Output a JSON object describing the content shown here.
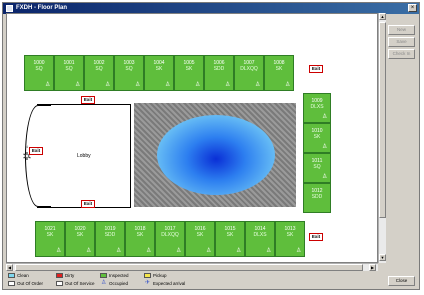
{
  "window": {
    "title": "FXDH - Floor Plan",
    "close_glyph": "×"
  },
  "exit_label": "Exit",
  "lobby_label": "Lobby",
  "compass_label": "N",
  "top_rooms": [
    {
      "number": "1000",
      "type": "SQ"
    },
    {
      "number": "1001",
      "type": "SQ"
    },
    {
      "number": "1002",
      "type": "SQ"
    },
    {
      "number": "1003",
      "type": "SQ"
    },
    {
      "number": "1004",
      "type": "SK"
    },
    {
      "number": "1005",
      "type": "SK"
    },
    {
      "number": "1006",
      "type": "SDD"
    },
    {
      "number": "1007",
      "type": "DLXQQ"
    },
    {
      "number": "1008",
      "type": "SK"
    }
  ],
  "right_rooms": [
    {
      "number": "1009",
      "type": "DLXS"
    },
    {
      "number": "1010",
      "type": "SK"
    },
    {
      "number": "1011",
      "type": "SQ"
    },
    {
      "number": "1012",
      "type": "SDD"
    }
  ],
  "bottom_rooms": [
    {
      "number": "1021",
      "type": "SK"
    },
    {
      "number": "1020",
      "type": "SK"
    },
    {
      "number": "1019",
      "type": "SDD"
    },
    {
      "number": "1018",
      "type": "SK"
    },
    {
      "number": "1017",
      "type": "DLXQQ"
    },
    {
      "number": "1016",
      "type": "SK"
    },
    {
      "number": "1015",
      "type": "SK"
    },
    {
      "number": "1014",
      "type": "DLXS"
    },
    {
      "number": "1013",
      "type": "SK"
    }
  ],
  "occupied_glyph": "♙",
  "side_buttons": {
    "new": "New",
    "save": "Save",
    "check_in": "Check In",
    "close": "Close"
  },
  "legend": {
    "clean": "Clean",
    "dirty": "Dirty",
    "inspected": "Inspected",
    "pickup": "Pickup",
    "out_of_order": "Out Of Order",
    "out_of_service": "Out Of Service",
    "occupied": "Occupied",
    "expected_arrival": "Expected arrival"
  },
  "colors": {
    "clean": "#7fd7ee",
    "dirty": "#e02020",
    "inspected": "#5fbe3c",
    "pickup": "#f5e64a",
    "out_of_order": "#ffffff",
    "out_of_service": "#ffffff"
  }
}
